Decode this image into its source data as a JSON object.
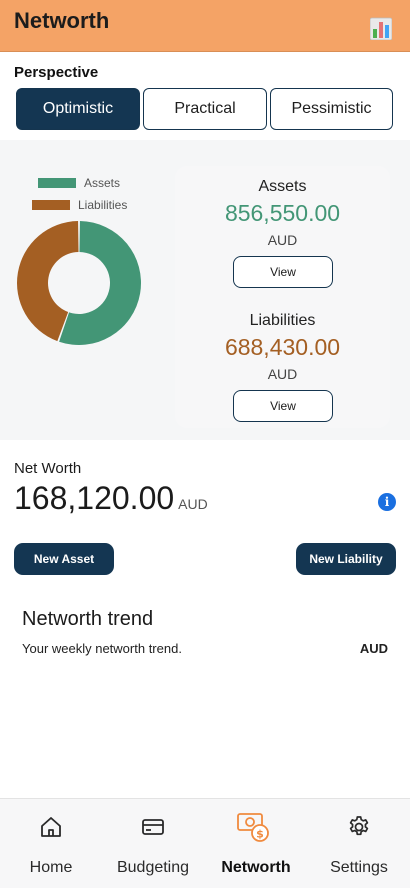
{
  "header": {
    "title": "Networth",
    "chart_icon": "bar-chart-icon"
  },
  "perspective": {
    "label": "Perspective",
    "options": [
      "Optimistic",
      "Practical",
      "Pessimistic"
    ],
    "selected": "Optimistic"
  },
  "legend": {
    "assets": "Assets",
    "liabilities": "Liabilities"
  },
  "colors": {
    "assets": "#439676",
    "liabilities": "#a45f23",
    "header": "#f4a366",
    "primary": "#143652",
    "accent_icon": "#f08a3e"
  },
  "chart_data": {
    "type": "pie",
    "categories": [
      "Assets",
      "Liabilities"
    ],
    "values": [
      856550.0,
      688430.0
    ]
  },
  "assets": {
    "title": "Assets",
    "value": "856,550.00",
    "unit": "AUD",
    "view_label": "View"
  },
  "liabilities": {
    "title": "Liabilities",
    "value": "688,430.00",
    "unit": "AUD",
    "view_label": "View"
  },
  "networth": {
    "label": "Net Worth",
    "value": "168,120.00",
    "unit": "AUD",
    "info_icon": "info-icon"
  },
  "actions": {
    "new_asset": "New Asset",
    "new_liability": "New Liability"
  },
  "trend": {
    "title": "Networth trend",
    "subtitle": "Your weekly networth trend.",
    "unit": "AUD"
  },
  "nav": {
    "items": [
      {
        "label": "Home",
        "icon": "home-icon"
      },
      {
        "label": "Budgeting",
        "icon": "card-icon"
      },
      {
        "label": "Networth",
        "icon": "money-icon"
      },
      {
        "label": "Settings",
        "icon": "gear-icon"
      }
    ],
    "active": "Networth"
  }
}
